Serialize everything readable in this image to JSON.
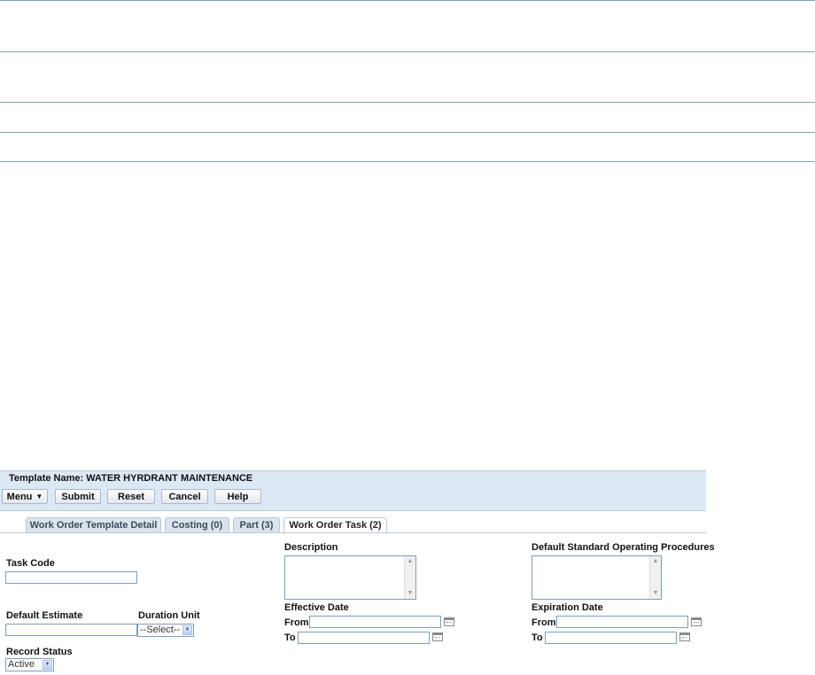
{
  "header": {
    "template_label": "Template Name:",
    "template_name": "WATER HYRDRANT MAINTENANCE",
    "buttons": {
      "menu": "Menu",
      "submit": "Submit",
      "reset": "Reset",
      "cancel": "Cancel",
      "help": "Help"
    }
  },
  "tabs": [
    {
      "label": "Work Order Template Detail",
      "active": false
    },
    {
      "label": "Costing (0)",
      "active": false
    },
    {
      "label": "Part (3)",
      "active": false
    },
    {
      "label": "Work Order Task (2)",
      "active": true
    }
  ],
  "form": {
    "task_code": {
      "label": "Task Code",
      "value": ""
    },
    "default_estimate": {
      "label": "Default Estimate",
      "value": ""
    },
    "duration_unit": {
      "label": "Duration Unit",
      "selected": "--Select--"
    },
    "record_status": {
      "label": "Record Status",
      "selected": "Active"
    },
    "description": {
      "label": "Description",
      "value": ""
    },
    "effective_date": {
      "label": "Effective Date",
      "from_label": "From",
      "to_label": "To"
    },
    "default_sop": {
      "label": "Default Standard Operating Procedures",
      "value": ""
    },
    "expiration_date": {
      "label": "Expiration Date",
      "from_label": "From",
      "to_label": "To"
    }
  },
  "icons": {
    "calendar": "calendar-icon",
    "dropdown": "chevron-down-icon",
    "menu_caret": "menu-caret-icon"
  },
  "colors": {
    "panel_bg": "#dde8f5",
    "divider": "#7fa7b0",
    "tab_bg": "#dbe3ec",
    "input_border": "#7f9db9"
  }
}
